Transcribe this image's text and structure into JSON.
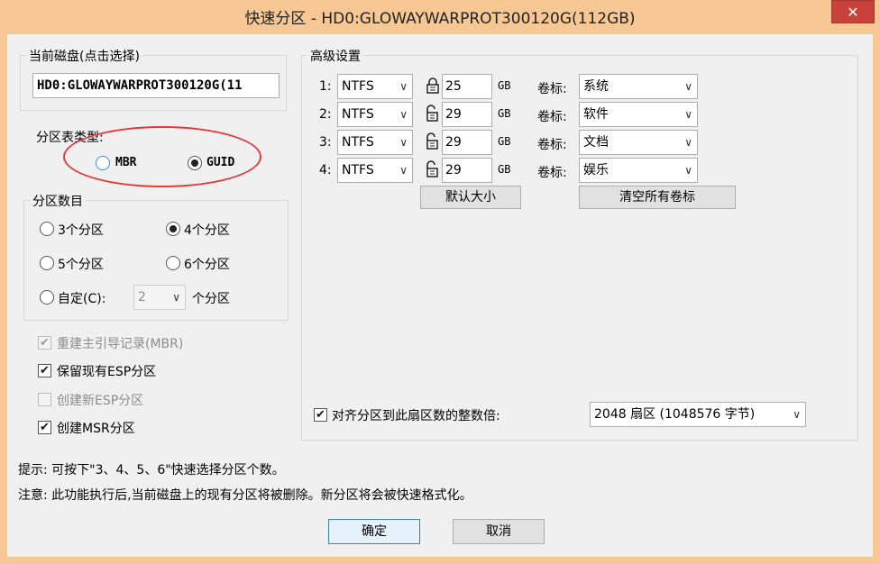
{
  "window": {
    "title": "快速分区 - HD0:GLOWAYWARPROT300120G(112GB)",
    "close_glyph": "✕"
  },
  "current_disk": {
    "group_label": "当前磁盘(点击选择)",
    "value": "HD0:GLOWAYWARPROT300120G(11"
  },
  "partition_table": {
    "label": "分区表类型:",
    "options": [
      {
        "label": "MBR",
        "checked": false
      },
      {
        "label": "GUID",
        "checked": true
      }
    ]
  },
  "partition_count": {
    "group_label": "分区数目",
    "options": [
      {
        "label": "3个分区",
        "checked": false
      },
      {
        "label": "4个分区",
        "checked": true
      },
      {
        "label": "5个分区",
        "checked": false
      },
      {
        "label": "6个分区",
        "checked": false
      }
    ],
    "custom_label": "自定(C):",
    "custom_value": "2",
    "custom_suffix": "个分区"
  },
  "checkboxes": [
    {
      "label": "重建主引导记录(MBR)",
      "checked": true,
      "disabled": true
    },
    {
      "label": "保留现有ESP分区",
      "checked": true,
      "disabled": false
    },
    {
      "label": "创建新ESP分区",
      "checked": false,
      "disabled": true
    },
    {
      "label": "创建MSR分区",
      "checked": true,
      "disabled": false
    }
  ],
  "advanced": {
    "group_label": "高级设置",
    "size_unit": "GB",
    "volume_label_caption": "卷标:",
    "rows": [
      {
        "index": "1:",
        "fs": "NTFS",
        "size": "25",
        "locked": true,
        "volume": "系统"
      },
      {
        "index": "2:",
        "fs": "NTFS",
        "size": "29",
        "locked": false,
        "volume": "软件"
      },
      {
        "index": "3:",
        "fs": "NTFS",
        "size": "29",
        "locked": false,
        "volume": "文档"
      },
      {
        "index": "4:",
        "fs": "NTFS",
        "size": "29",
        "locked": false,
        "volume": "娱乐"
      }
    ],
    "default_size_button": "默认大小",
    "clear_labels_button": "清空所有卷标",
    "align_checkbox_label": "对齐分区到此扇区数的整数倍:",
    "align_checked": true,
    "align_value": "2048 扇区 (1048576 字节)"
  },
  "tips": {
    "hint": "提示: 可按下\"3、4、5、6\"快速选择分区个数。",
    "warning": "注意: 此功能执行后,当前磁盘上的现有分区将被删除。新分区将会被快速格式化。"
  },
  "buttons": {
    "ok": "确定",
    "cancel": "取消"
  },
  "arrow_glyph": "∨",
  "check_glyph": "✔"
}
